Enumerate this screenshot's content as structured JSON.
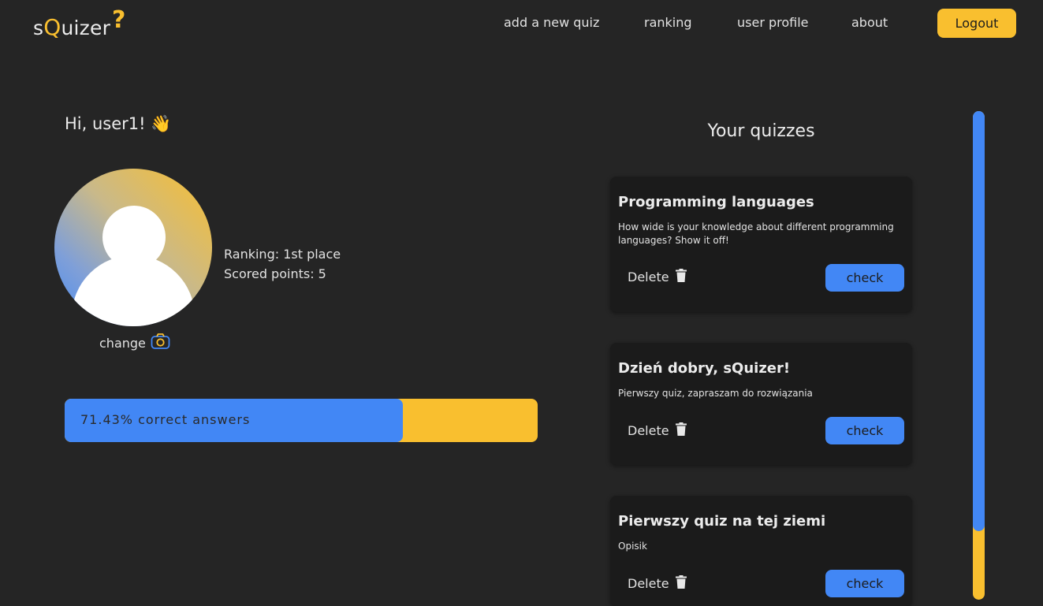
{
  "nav": {
    "logo_prefix": "s",
    "logo_q": "Q",
    "logo_suffix": "uizer",
    "logo_mark": "?",
    "links": [
      "add a new quiz",
      "ranking",
      "user profile",
      "about"
    ],
    "logout_label": "Logout"
  },
  "profile": {
    "greeting": "Hi, user1! 👋",
    "change_label": "change",
    "change_icon": "camera-icon",
    "ranking": "Ranking: 1st place",
    "points": "Scored points: 5",
    "correct_label": "71.43% correct answers",
    "correct_fraction": 0.7143
  },
  "quizzes": {
    "title": "Your quizzes",
    "delete_label": "Delete",
    "delete_icon": "trash-icon",
    "check_label": "check",
    "items": [
      {
        "title": "Programming languages",
        "description": "How wide is your knowledge about different programming languages? Show it off!"
      },
      {
        "title": "Dzień dobry, sQuizer!",
        "description": "Pierwszy quiz, zapraszam do rozwiązania"
      },
      {
        "title": "Pierwszy quiz na tej ziemi",
        "description": "Opisik"
      }
    ]
  },
  "colors": {
    "background": "#252525",
    "accent_yellow": "#f9bf2f",
    "accent_blue": "#4287f5",
    "card": "#1b1b1b"
  }
}
